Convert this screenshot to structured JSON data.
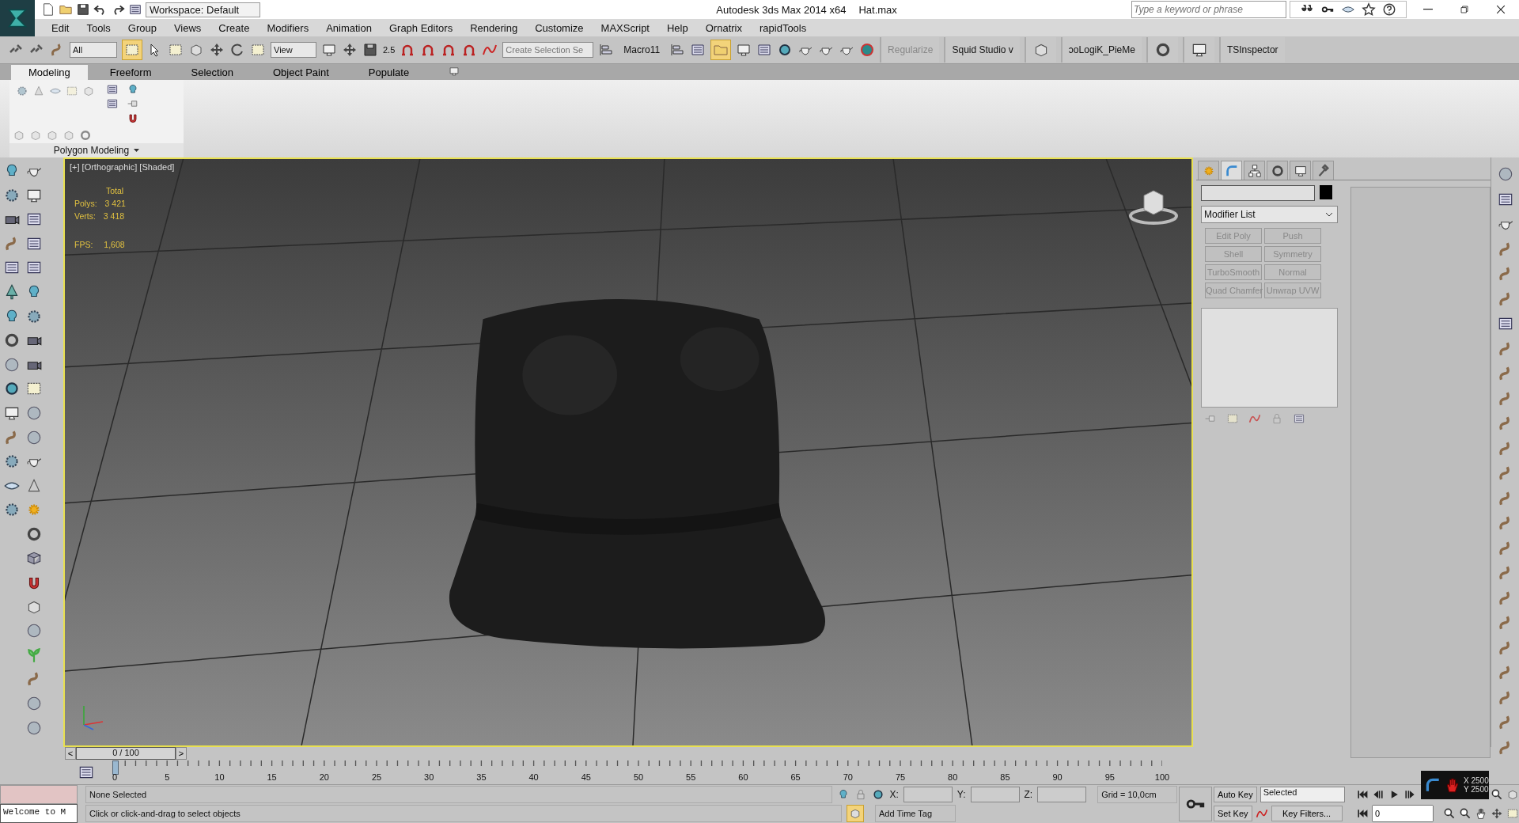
{
  "title_bar": {
    "workspace": "Workspace: Default",
    "app_title": "Autodesk 3ds Max  2014 x64",
    "file_name": "Hat.max",
    "search_placeholder": "Type a keyword or phrase"
  },
  "menu": [
    "Edit",
    "Tools",
    "Group",
    "Views",
    "Create",
    "Modifiers",
    "Animation",
    "Graph Editors",
    "Rendering",
    "Customize",
    "MAXScript",
    "Help",
    "Ornatrix",
    "rapidTools"
  ],
  "main_toolbar": {
    "selection_filter": "All",
    "reference_coordinates": "View",
    "snap_label": "2.5",
    "named_selection_placeholder": "Create Selection Se",
    "macro": "Macro11",
    "plugins": [
      {
        "label": "Regularize",
        "disabled": true
      },
      {
        "label": "Squid Studio v",
        "disabled": false
      },
      {
        "label": "ɔoLogiK_PieMe",
        "disabled": false
      },
      {
        "label": "TSInspector",
        "disabled": false
      }
    ]
  },
  "ribbon": {
    "tabs": [
      {
        "label": "Modeling",
        "selected": true
      },
      {
        "label": "Freeform",
        "selected": false
      },
      {
        "label": "Selection",
        "selected": false
      },
      {
        "label": "Object Paint",
        "selected": false
      },
      {
        "label": "Populate",
        "selected": false
      }
    ],
    "panel_label": "Polygon Modeling"
  },
  "viewport": {
    "label": "[+] [Orthographic] [Shaded]",
    "stats_header": "Total",
    "stats": [
      {
        "label": "Polys:",
        "value": "3 421"
      },
      {
        "label": "Verts:",
        "value": "3 418"
      }
    ],
    "fps_label": "FPS:",
    "fps": "1,608"
  },
  "command_panel": {
    "tabs": [
      {
        "kind": "create",
        "selected": false
      },
      {
        "kind": "modify",
        "selected": true
      },
      {
        "kind": "hierarchy",
        "selected": false
      },
      {
        "kind": "motion",
        "selected": false
      },
      {
        "kind": "display",
        "selected": false
      },
      {
        "kind": "utilities",
        "selected": false
      }
    ],
    "modifier_list": "Modifier List",
    "modifier_buttons": [
      "Edit Poly",
      "Push",
      "Shell",
      "Symmetry",
      "TurboSmooth",
      "Normal",
      "Quad Chamfer",
      "Unwrap UVW"
    ]
  },
  "time_slider": {
    "position": "0 / 100",
    "prev": "<",
    "next": ">"
  },
  "track_bar": {
    "labels": [
      "0",
      "5",
      "10",
      "15",
      "20",
      "25",
      "30",
      "35",
      "40",
      "45",
      "50",
      "55",
      "60",
      "65",
      "70",
      "75",
      "80",
      "85",
      "90",
      "95",
      "100"
    ]
  },
  "status_bar": {
    "listener": "Welcome to M",
    "selection": "None Selected",
    "prompt": "Click or click-and-drag to select objects",
    "x_label": "X:",
    "y_label": "Y:",
    "z_label": "Z:",
    "grid": "Grid = 10,0cm",
    "time_tag": "Add Time Tag",
    "auto_key": "Auto Key",
    "set_key": "Set Key",
    "key_mode": "Selected",
    "key_filters": "Key Filters...",
    "frame": "0"
  },
  "overlay": {
    "x": "X 2500",
    "y": "Y 2500"
  }
}
